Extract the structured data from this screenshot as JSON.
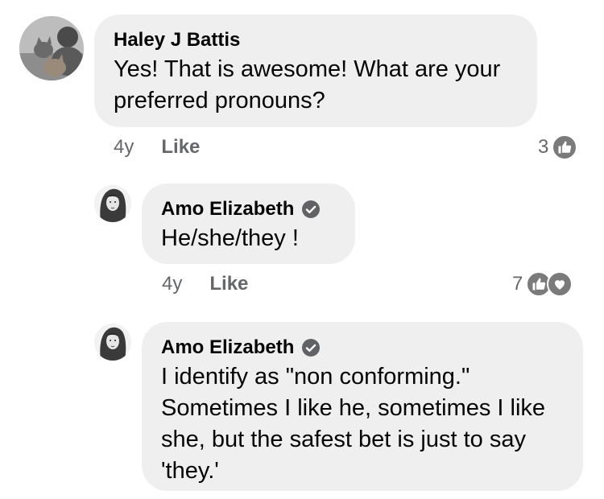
{
  "comments": [
    {
      "author": "Haley J Battis",
      "verified": false,
      "text": "Yes! That is awesome! What are your preferred pronouns?",
      "time": "4y",
      "like_label": "Like",
      "reaction_count": "3",
      "reactions": [
        "like-icon"
      ]
    },
    {
      "author": "Amo Elizabeth",
      "verified": true,
      "text": "He/she/they !",
      "time": "4y",
      "like_label": "Like",
      "reaction_count": "7",
      "reactions": [
        "like-icon",
        "heart-icon"
      ]
    },
    {
      "author": "Amo Elizabeth",
      "verified": true,
      "text": "I identify as \"non conforming.\" Sometimes I like he, sometimes I like she, but the safest bet is just to say 'they.'"
    }
  ],
  "colors": {
    "bubble": "#efefef",
    "name": "#050505",
    "meta": "#65676b",
    "reaction_icon": "#7a7a7a"
  }
}
